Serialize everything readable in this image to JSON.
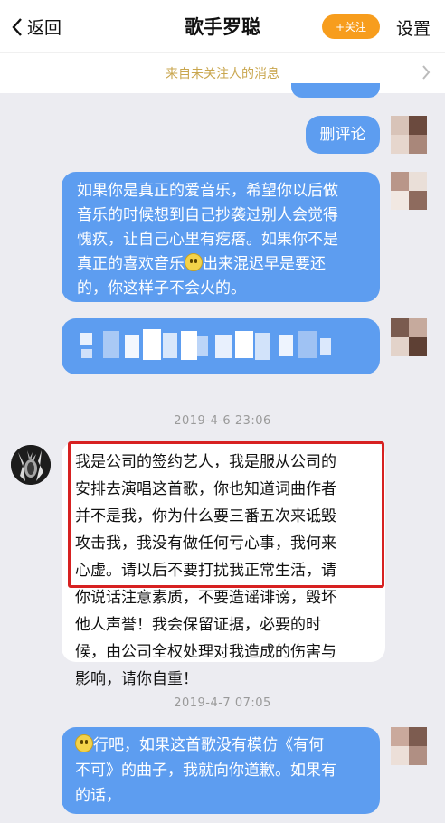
{
  "header": {
    "back_label": "返回",
    "title": "歌手罗聪",
    "follow_label": "+关注",
    "settings_label": "设置"
  },
  "notice": {
    "text": "来自未关注人的消息"
  },
  "messages": {
    "m1": {
      "text": "删评论"
    },
    "m2": {
      "lines": [
        "如果你是真正的爱音乐，希望你以后做",
        "音乐的时候想到自己抄袭过别人会觉得",
        "愧疚，让自己心里有疙瘩。如果你不是"
      ],
      "line4_a": "真正的喜欢音乐",
      "line4_b": "出来混迟早是要还",
      "line5": "的，你这样子不会火的。"
    },
    "ts1": "2019-4-6 23:06",
    "m4": {
      "lines": [
        "我是公司的签约艺人，我是服从公司的",
        "安排去演唱这首歌，你也知道词曲作者",
        "并不是我，你为什么要三番五次来诋毁",
        "攻击我，我没有做任何亏心事，我何来",
        "心虚。请以后不要打扰我正常生活，请",
        "你说话注意素质，不要造谣诽谤，毁坏",
        "他人声誉！我会保留证据，必要的时",
        "候，由公司全权处理对我造成的伤害与",
        "影响，请你自重！"
      ]
    },
    "ts2": "2019-4-7 07:05",
    "m5": {
      "line1_b": "行吧，如果这首歌没有模仿《有何",
      "line2": "不可》的曲子，我就向你道歉。如果有",
      "line3": "的话，"
    }
  },
  "colors": {
    "accent_blue": "#5d9df0",
    "follow_orange": "#f79d1d",
    "notice_gold": "#c9a64e",
    "highlight_red": "#d72121"
  },
  "icons": [
    "chevron-left-icon",
    "chevron-right-icon",
    "smile-emoji-icon"
  ]
}
